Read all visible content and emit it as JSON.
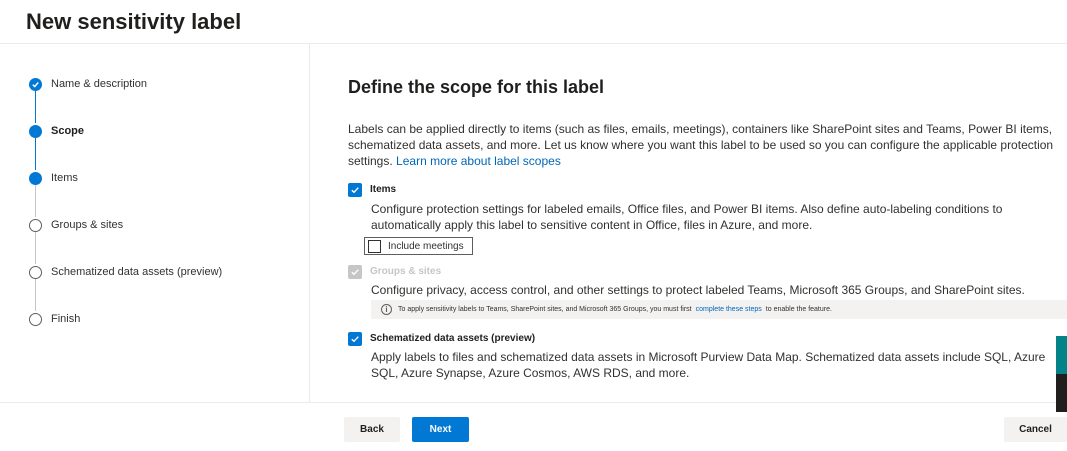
{
  "page": {
    "title": "New sensitivity label"
  },
  "steps": [
    {
      "label": "Name & description",
      "state": "completed"
    },
    {
      "label": "Scope",
      "state": "current"
    },
    {
      "label": "Items",
      "state": "upcoming-active"
    },
    {
      "label": "Groups & sites",
      "state": "upcoming"
    },
    {
      "label": "Schematized data assets (preview)",
      "state": "upcoming"
    },
    {
      "label": "Finish",
      "state": "upcoming"
    }
  ],
  "main": {
    "title": "Define the scope for this label",
    "intro_text": "Labels can be applied directly to items (such as files, emails, meetings), containers like SharePoint sites and Teams, Power BI items, schematized data assets, and more. Let us know where you want this label to be used so you can configure the applicable protection settings.",
    "intro_link": "Learn more about label scopes",
    "options": {
      "items": {
        "label": "Items",
        "checked": true,
        "description": "Configure protection settings for labeled emails, Office files, and Power BI items. Also define auto-labeling conditions to automatically apply this label to sensitive content in Office, files in Azure, and more.",
        "meetings_label": "Include meetings",
        "meetings_checked": false
      },
      "groups": {
        "label": "Groups & sites",
        "checked": true,
        "disabled": true,
        "description": "Configure privacy, access control, and other settings to protect labeled Teams, Microsoft 365 Groups, and SharePoint sites.",
        "info_text": "To apply sensitivity labels to Teams, SharePoint sites, and Microsoft 365 Groups, you must first",
        "info_link": "complete these steps",
        "info_suffix": "to enable the feature."
      },
      "schematized": {
        "label": "Schematized data assets (preview)",
        "checked": true,
        "description": "Apply labels to files and schematized data assets in Microsoft Purview Data Map. Schematized data assets include SQL, Azure SQL, Azure Synapse, Azure Cosmos, AWS RDS, and more."
      }
    }
  },
  "footer": {
    "back_label": "Back",
    "next_label": "Next",
    "cancel_label": "Cancel"
  },
  "colors": {
    "accent": "#0078d4",
    "link": "#0067b8",
    "disabled": "#c8c6c4"
  }
}
